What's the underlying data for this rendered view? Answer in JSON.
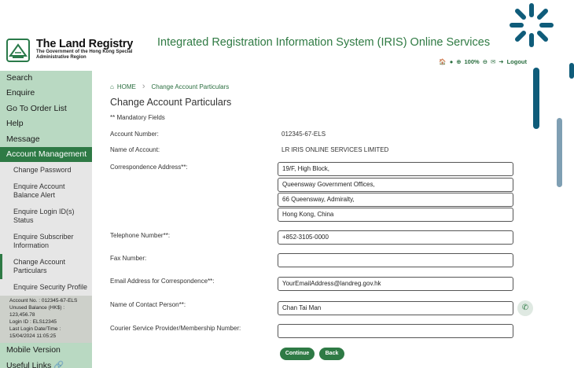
{
  "header": {
    "logo_title": "The Land Registry",
    "logo_sub": "The Government of the Hong Kong Special Administrative Region",
    "system_title": "Integrated Registration Information System (IRIS) Online Services",
    "zoom": "100%",
    "logout_label": "Logout"
  },
  "sidebar": {
    "items": [
      {
        "label": "Search"
      },
      {
        "label": "Enquire"
      },
      {
        "label": "Go To Order List"
      },
      {
        "label": "Help"
      },
      {
        "label": "Message"
      },
      {
        "label": "Account Management"
      }
    ],
    "sub_items": [
      {
        "label": "Change Password"
      },
      {
        "label": "Enquire Account Balance Alert"
      },
      {
        "label": "Enquire Login ID(s) Status"
      },
      {
        "label": "Enquire Subscriber Information"
      },
      {
        "label": "Change Account Particulars"
      },
      {
        "label": "Enquire Security Profile"
      }
    ],
    "account_info": {
      "account_no": "Account No. : 012345-67-ELS",
      "balance_label": "Unused Balance (HK$) :",
      "balance_value": "123,456.78",
      "login_id": "Login ID : ELS12345",
      "last_login_label": "Last Login Date/Time :",
      "last_login_value": "15/04/2024 11:05:25"
    },
    "bottom_items": [
      {
        "label": "Mobile Version"
      },
      {
        "label": "Useful Links"
      }
    ]
  },
  "main": {
    "breadcrumb_home": "HOME",
    "breadcrumb_current": "Change Account Particulars",
    "page_title": "Change Account Particulars",
    "mandatory_note": "** Mandatory Fields",
    "account_number_label": "Account Number:",
    "account_number_value": "012345-67-ELS",
    "account_name_label": "Name of Account:",
    "account_name_value": "LR IRIS ONLINE SERVICES LIMITED",
    "address_label": "Correspondence Address**:",
    "address_lines": [
      "19/F, High Block,",
      "Queensway Government Offices,",
      "66 Queensway, Admiralty,",
      "Hong Kong, China"
    ],
    "telephone_label": "Telephone Number**:",
    "telephone_value": "+852-3105-0000",
    "fax_label": "Fax Number:",
    "fax_value": "",
    "email_label": "Email Address for Correspondence**:",
    "email_value": "YourEmailAddress@landreg.gov.hk",
    "contact_label": "Name of Contact Person**:",
    "contact_value": "Chan Tai Man",
    "courier_label": "Courier Service Provider/Membership Number:",
    "courier_value": "",
    "continue_label": "Continue",
    "back_label": "Back"
  },
  "colors": {
    "brand_green": "#2e7a45",
    "sidebar_bg": "#b9d9c2"
  }
}
